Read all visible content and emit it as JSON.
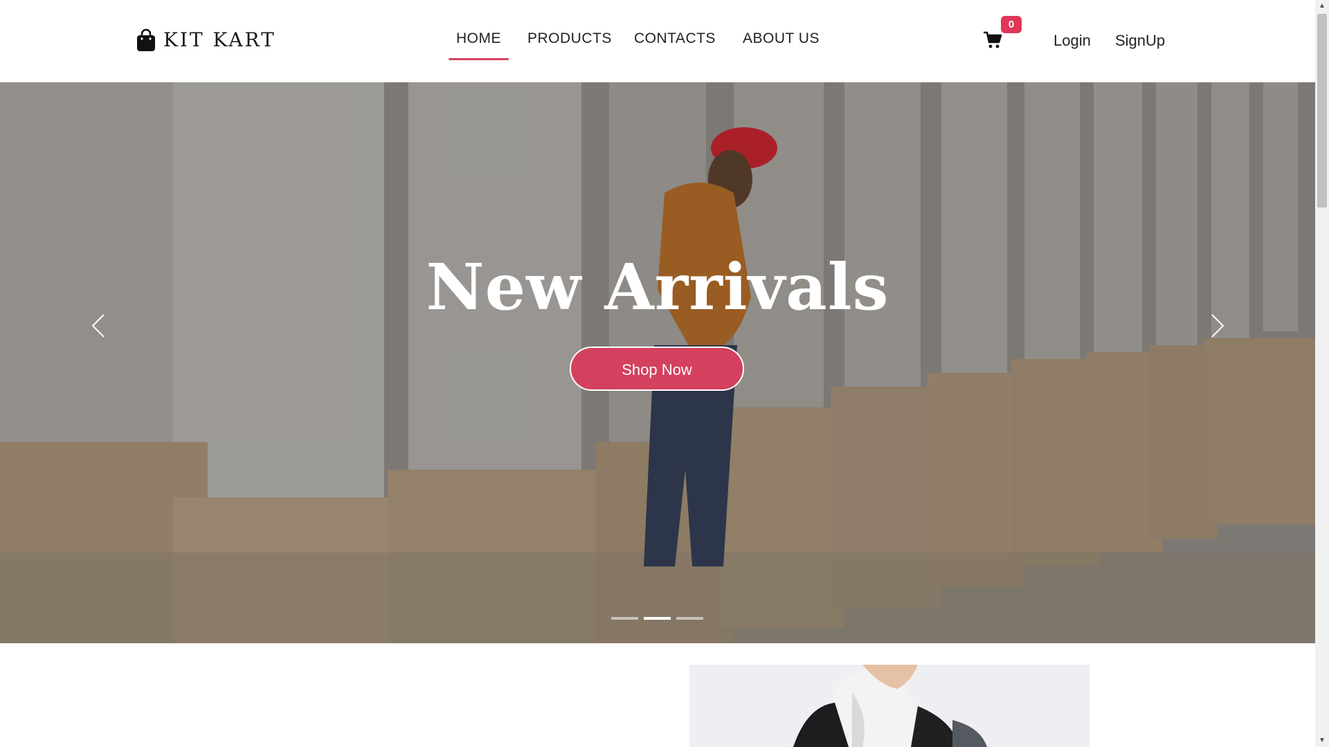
{
  "brand": {
    "name": "KIT KART",
    "icon": "shopping-bag-icon"
  },
  "nav": {
    "items": [
      {
        "label": "HOME",
        "active": true
      },
      {
        "label": "PRODUCTS",
        "active": false
      },
      {
        "label": "CONTACTS",
        "active": false
      },
      {
        "label": "ABOUT US",
        "active": false
      }
    ]
  },
  "cart": {
    "icon": "cart-icon",
    "count": "0"
  },
  "auth": {
    "login": "Login",
    "signup": "SignUp"
  },
  "hero": {
    "title": "New Arrivals",
    "cta": "Shop Now",
    "prev_icon": "chevron-left-icon",
    "next_icon": "chevron-right-icon",
    "slide_count": 3,
    "active_slide": 2
  },
  "colors": {
    "accent": "#d3415e",
    "badge": "#e0365a",
    "text": "#222222"
  }
}
